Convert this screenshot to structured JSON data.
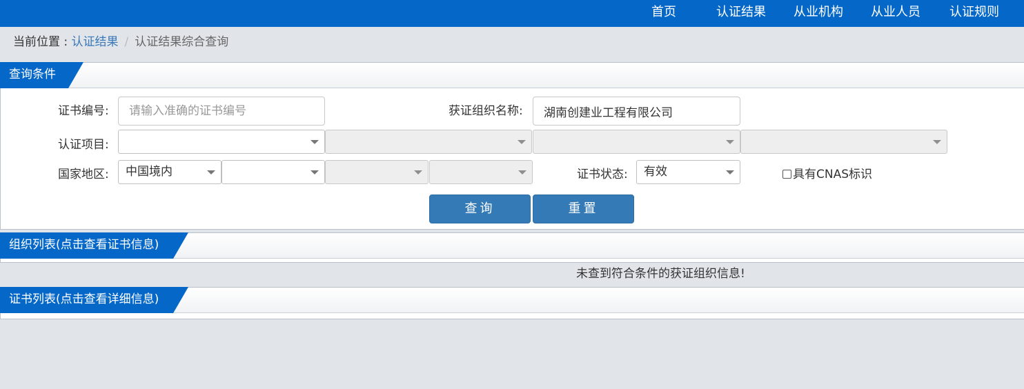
{
  "nav": {
    "items": [
      "首页",
      "认证结果",
      "从业机构",
      "从业人员",
      "认证规则"
    ]
  },
  "breadcrumb": {
    "prefix": "当前位置 : ",
    "link": "认证结果",
    "separator": "/",
    "current": "认证结果综合查询"
  },
  "query_panel": {
    "title": "查询条件",
    "cert_no_label": "证书编号:",
    "cert_no_placeholder": "请输入准确的证书编号",
    "cert_no_value": "",
    "org_name_label": "获证组织名称:",
    "org_name_value": "湖南创建业工程有限公司",
    "project_label": "认证项目:",
    "project_select_value": "",
    "region_label": "国家地区:",
    "region_select_1": "中国境内",
    "region_select_2": "",
    "status_label": "证书状态:",
    "status_value": "有效",
    "cnas_label": "具有CNAS标识",
    "query_button": "查询",
    "reset_button": "重置"
  },
  "org_panel": {
    "title": "组织列表(点击查看证书信息)",
    "empty_message": "未查到符合条件的获证组织信息!"
  },
  "cert_panel": {
    "title": "证书列表(点击查看详细信息)"
  },
  "colors": {
    "brand_blue": "#0568c9",
    "button_blue": "#337ab7",
    "background": "#e1e5ea"
  }
}
